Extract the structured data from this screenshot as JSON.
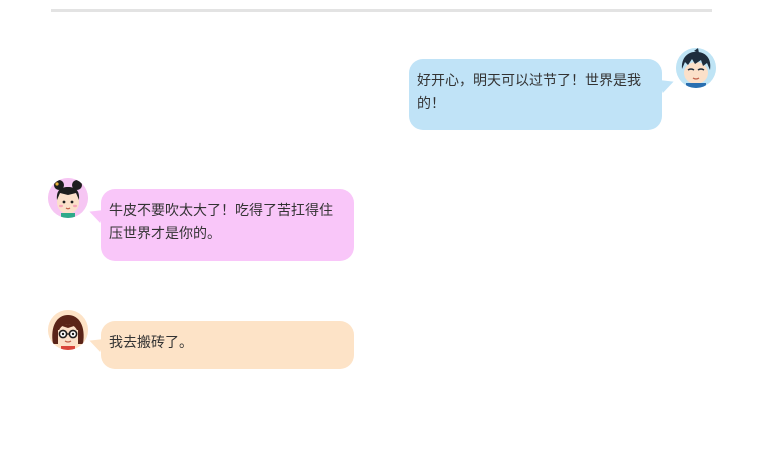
{
  "messages": [
    {
      "side": "right",
      "sender_icon": "boy-avatar-icon",
      "text": "好开心，明天可以过节了！世界是我的！",
      "bubble_color": "#c0e3f7"
    },
    {
      "side": "left",
      "sender_icon": "girl-avatar-icon",
      "text": "牛皮不要吹太大了！吃得了苦扛得住压世界才是你的。",
      "bubble_color": "#f9c6f9"
    },
    {
      "side": "left",
      "sender_icon": "glasses-girl-avatar-icon",
      "text": "我去搬砖了。",
      "bubble_color": "#fde3c7"
    }
  ]
}
